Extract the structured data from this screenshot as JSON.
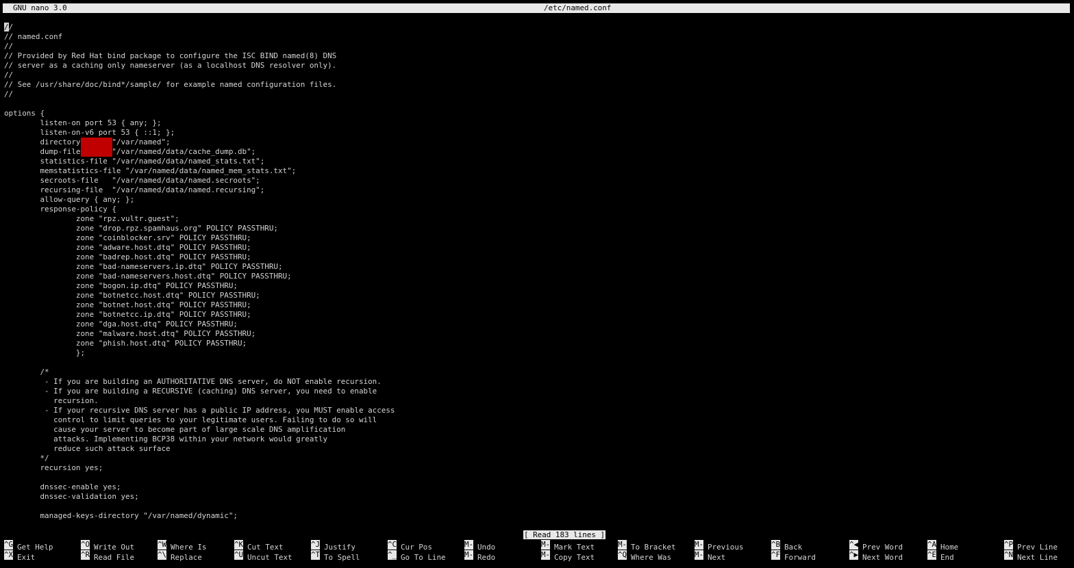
{
  "titlebar": {
    "app": "GNU nano 3.0",
    "file": "/etc/named.conf"
  },
  "editor": {
    "lines": [
      "//",
      "// named.conf",
      "//",
      "// Provided by Red Hat bind package to configure the ISC BIND named(8) DNS",
      "// server as a caching only nameserver (as a localhost DNS resolver only).",
      "//",
      "// See /usr/share/doc/bind*/sample/ for example named configuration files.",
      "//",
      "",
      "options {",
      "        listen-on port 53 { any; };",
      "        listen-on-v6 port 53 { ::1; };",
      "        directory       \"/var/named\";",
      "        dump-file       \"/var/named/data/cache_dump.db\";",
      "        statistics-file \"/var/named/data/named_stats.txt\";",
      "        memstatistics-file \"/var/named/data/named_mem_stats.txt\";",
      "        secroots-file   \"/var/named/data/named.secroots\";",
      "        recursing-file  \"/var/named/data/named.recursing\";",
      "        allow-query { any; };",
      "        response-policy {",
      "                zone \"rpz.vultr.guest\";",
      "                zone \"drop.rpz.spamhaus.org\" POLICY PASSTHRU;",
      "                zone \"coinblocker.srv\" POLICY PASSTHRU;",
      "                zone \"adware.host.dtq\" POLICY PASSTHRU;",
      "                zone \"badrep.host.dtq\" POLICY PASSTHRU;",
      "                zone \"bad-nameservers.ip.dtq\" POLICY PASSTHRU;",
      "                zone \"bad-nameservers.host.dtq\" POLICY PASSTHRU;",
      "                zone \"bogon.ip.dtq\" POLICY PASSTHRU;",
      "                zone \"botnetcc.host.dtq\" POLICY PASSTHRU;",
      "                zone \"botnet.host.dtq\" POLICY PASSTHRU;",
      "                zone \"botnetcc.ip.dtq\" POLICY PASSTHRU;",
      "                zone \"dga.host.dtq\" POLICY PASSTHRU;",
      "                zone \"malware.host.dtq\" POLICY PASSTHRU;",
      "                zone \"phish.host.dtq\" POLICY PASSTHRU;",
      "                };",
      "",
      "        /*",
      "         - If you are building an AUTHORITATIVE DNS server, do NOT enable recursion.",
      "         - If you are building a RECURSIVE (caching) DNS server, you need to enable",
      "           recursion.",
      "         - If your recursive DNS server has a public IP address, you MUST enable access",
      "           control to limit queries to your legitimate users. Failing to do so will",
      "           cause your server to become part of large scale DNS amplification",
      "           attacks. Implementing BCP38 within your network would greatly",
      "           reduce such attack surface",
      "        */",
      "        recursion yes;",
      "",
      "        dnssec-enable yes;",
      "        dnssec-validation yes;",
      "",
      "        managed-keys-directory \"/var/named/dynamic\";"
    ]
  },
  "status": "[ Read 183 lines ]",
  "shortcuts": [
    {
      "key": "^G",
      "label": "Get Help"
    },
    {
      "key": "^X",
      "label": "Exit"
    },
    {
      "key": "^O",
      "label": "Write Out"
    },
    {
      "key": "^R",
      "label": "Read File"
    },
    {
      "key": "^W",
      "label": "Where Is"
    },
    {
      "key": "^\\",
      "label": "Replace"
    },
    {
      "key": "^K",
      "label": "Cut Text"
    },
    {
      "key": "^U",
      "label": "Uncut Text"
    },
    {
      "key": "^J",
      "label": "Justify"
    },
    {
      "key": "^T",
      "label": "To Spell"
    },
    {
      "key": "^C",
      "label": "Cur Pos"
    },
    {
      "key": "^_",
      "label": "Go To Line"
    },
    {
      "key": "M-U",
      "label": "Undo"
    },
    {
      "key": "M-E",
      "label": "Redo"
    },
    {
      "key": "M-A",
      "label": "Mark Text"
    },
    {
      "key": "M-6",
      "label": "Copy Text"
    },
    {
      "key": "M-]",
      "label": "To Bracket"
    },
    {
      "key": "^Q",
      "label": "Where Was"
    },
    {
      "key": "M-Q",
      "label": "Previous"
    },
    {
      "key": "M-W",
      "label": "Next"
    },
    {
      "key": "^B",
      "label": "Back"
    },
    {
      "key": "^F",
      "label": "Forward"
    },
    {
      "key": "^◀",
      "label": "Prev Word"
    },
    {
      "key": "^▶",
      "label": "Next Word"
    },
    {
      "key": "^A",
      "label": "Home"
    },
    {
      "key": "^E",
      "label": "End"
    },
    {
      "key": "^P",
      "label": "Prev Line"
    },
    {
      "key": "^N",
      "label": "Next Line"
    }
  ],
  "colors": {
    "background": "#000000",
    "text": "#d4d4d4",
    "inverse_bg": "#e8e8e8",
    "redaction": "#c00000"
  }
}
